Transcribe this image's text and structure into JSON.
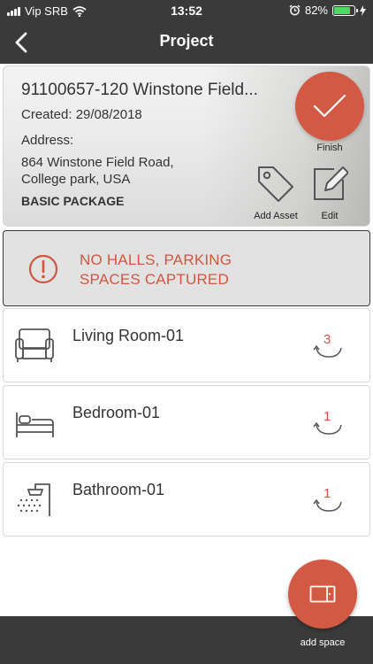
{
  "status_bar": {
    "carrier": "Vip SRB",
    "time": "13:52",
    "battery": "82%",
    "battery_level": 0.82
  },
  "header": {
    "title": "Project"
  },
  "project": {
    "name": "91100657-120 Winstone Field...",
    "created": "Created: 29/08/2018",
    "address_label": "Address:",
    "address_line1": "864 Winstone Field Road,",
    "address_line2": "College park, USA",
    "package": "BASIC PACKAGE",
    "finish_label": "Finish",
    "add_asset_label": "Add Asset",
    "edit_label": "Edit"
  },
  "warning": {
    "line1": "NO HALLS, PARKING",
    "line2": "SPACES CAPTURED"
  },
  "spaces": [
    {
      "name": "Living Room-01",
      "count": "3",
      "icon": "armchair-icon"
    },
    {
      "name": "Bedroom-01",
      "count": "1",
      "icon": "bed-icon"
    },
    {
      "name": "Bathroom-01",
      "count": "1",
      "icon": "shower-icon"
    }
  ],
  "footer": {
    "add_space_label": "add space"
  },
  "colors": {
    "accent": "#d25a44",
    "bar": "#3a3a3a",
    "warning_text": "#d1563f"
  }
}
